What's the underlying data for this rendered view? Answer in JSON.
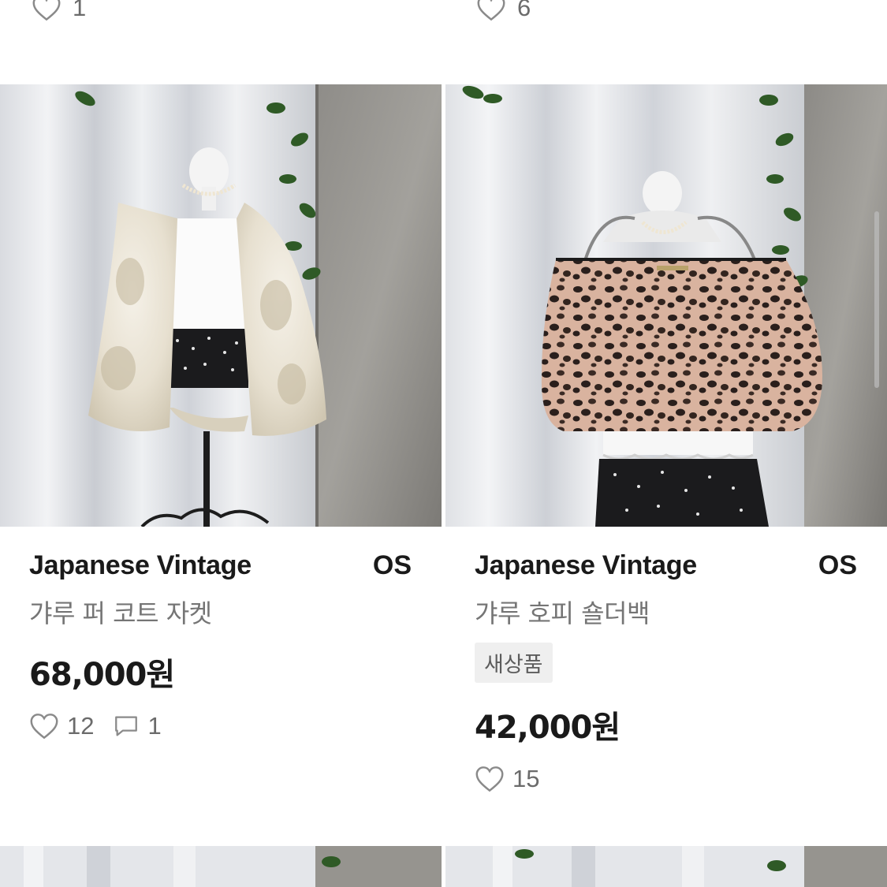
{
  "top_row": {
    "left_likes": "1",
    "right_likes": "6"
  },
  "products": [
    {
      "brand": "Japanese Vintage",
      "size": "OS",
      "name": "갸루 퍼 코트 자켓",
      "badge": "",
      "price": "68,000원",
      "likes": "12",
      "comments": "1"
    },
    {
      "brand": "Japanese Vintage",
      "size": "OS",
      "name": "갸루 호피 숄더백",
      "badge": "새상품",
      "price": "42,000원",
      "likes": "15",
      "comments": ""
    }
  ],
  "icons": {
    "like": "heart-outline-icon",
    "comment": "chat-bubble-icon"
  },
  "colors": {
    "text_primary": "#1a1a1a",
    "text_secondary": "#757575",
    "badge_bg": "#efefef"
  }
}
